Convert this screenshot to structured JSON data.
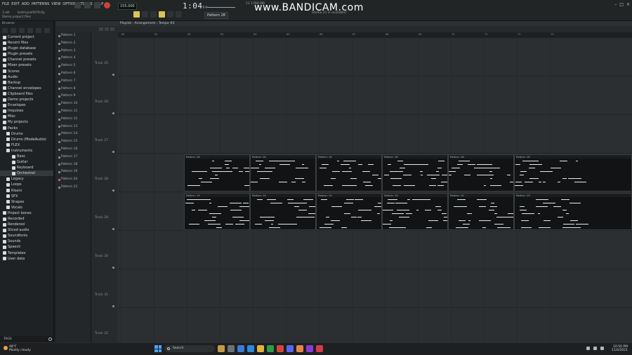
{
  "menu": [
    "FILE",
    "EDIT",
    "ADD",
    "PATTERNS",
    "VIEW",
    "OPTIONS",
    "TOOLS",
    "HELP"
  ],
  "hint_file": "3 ott",
  "hint_song": "lostmyself479.flp",
  "hint_project": "Demo project files",
  "tempo": "155.000",
  "time_main": "1:04",
  "time_small": "64",
  "cpu_text": "11  1780 MB",
  "watermark": "www.BANDICAM.com",
  "studio_note": "Studio 21 is available!",
  "pattern_selector": "Pattern 28",
  "playlist_title": "Playlist - Arrangement › Tempo #2",
  "browser_header": "Browser",
  "browser_items": [
    {
      "label": "Current project",
      "level": 0,
      "icon": "folder-icon"
    },
    {
      "label": "Recent files",
      "level": 0,
      "icon": "clock-icon"
    },
    {
      "label": "Plugin database",
      "level": 0,
      "icon": "plug-icon"
    },
    {
      "label": "Plugin presets",
      "level": 0,
      "icon": "plug-icon"
    },
    {
      "label": "Channel presets",
      "level": 0,
      "icon": "plug-icon"
    },
    {
      "label": "Mixer presets",
      "level": 0,
      "icon": "plug-icon"
    },
    {
      "label": "Scores",
      "level": 0,
      "icon": "note-icon"
    },
    {
      "label": "Audio",
      "level": 0,
      "icon": "audio-icon"
    },
    {
      "label": "Backup",
      "level": 0,
      "icon": "folder-icon"
    },
    {
      "label": "Channel envelopes",
      "level": 0,
      "icon": "folder-icon"
    },
    {
      "label": "Clipboard files",
      "level": 0,
      "icon": "folder-icon"
    },
    {
      "label": "Demo projects",
      "level": 0,
      "icon": "folder-icon"
    },
    {
      "label": "Envelopes",
      "level": 0,
      "icon": "folder-icon"
    },
    {
      "label": "Impulses",
      "level": 0,
      "icon": "folder-icon"
    },
    {
      "label": "Misc",
      "level": 0,
      "icon": "folder-icon"
    },
    {
      "label": "My projects",
      "level": 0,
      "icon": "folder-icon"
    },
    {
      "label": "Packs",
      "level": 0,
      "icon": "folder-open-icon"
    },
    {
      "label": "Drums",
      "level": 1,
      "icon": "folder-icon"
    },
    {
      "label": "Drums (ModeAudio)",
      "level": 1,
      "icon": "folder-icon"
    },
    {
      "label": "FLEX",
      "level": 1,
      "icon": "folder-icon"
    },
    {
      "label": "Instruments",
      "level": 1,
      "icon": "folder-open-icon"
    },
    {
      "label": "Bass",
      "level": 2,
      "icon": "folder-icon"
    },
    {
      "label": "Guitar",
      "level": 2,
      "icon": "folder-icon"
    },
    {
      "label": "Keyboard",
      "level": 2,
      "icon": "folder-icon"
    },
    {
      "label": "Orchestral",
      "level": 2,
      "icon": "folder-icon"
    },
    {
      "label": "Legacy",
      "level": 1,
      "icon": "folder-icon"
    },
    {
      "label": "Loops",
      "level": 1,
      "icon": "folder-icon"
    },
    {
      "label": "Risers",
      "level": 1,
      "icon": "folder-icon"
    },
    {
      "label": "SFX",
      "level": 1,
      "icon": "folder-icon"
    },
    {
      "label": "Shapes",
      "level": 1,
      "icon": "folder-icon"
    },
    {
      "label": "Vocals",
      "level": 1,
      "icon": "folder-icon"
    },
    {
      "label": "Project bones",
      "level": 0,
      "icon": "folder-icon"
    },
    {
      "label": "Recorded",
      "level": 0,
      "icon": "folder-icon"
    },
    {
      "label": "Rendered",
      "level": 0,
      "icon": "folder-icon"
    },
    {
      "label": "Sliced audio",
      "level": 0,
      "icon": "folder-icon"
    },
    {
      "label": "Soundfonts",
      "level": 0,
      "icon": "folder-icon"
    },
    {
      "label": "Sounds",
      "level": 0,
      "icon": "cloud-icon"
    },
    {
      "label": "Speech",
      "level": 0,
      "icon": "folder-icon"
    },
    {
      "label": "Templates",
      "level": 0,
      "icon": "folder-icon"
    },
    {
      "label": "User data",
      "level": 0,
      "icon": "folder-icon"
    }
  ],
  "browser_search": "TAGS",
  "patterns": [
    "Pattern 1",
    "Pattern 2",
    "Pattern 3",
    "Pattern 4",
    "Pattern 5",
    "Pattern 6",
    "Pattern 7",
    "Pattern 8",
    "Pattern 9",
    "Pattern 10",
    "Pattern 11",
    "Pattern 12",
    "Pattern 13",
    "Pattern 14",
    "Pattern 15",
    "Pattern 16",
    "Pattern 17",
    "Pattern 18",
    "Pattern 19",
    "Pattern 20",
    "Pattern 21"
  ],
  "tracks": [
    "Track 25",
    "Track 26",
    "Track 27",
    "Track 28",
    "Track 29",
    "Track 30",
    "Track 31",
    "Track 32"
  ],
  "ruler_ticks": [
    "60",
    "61",
    "62",
    "63",
    "64",
    "65",
    "66",
    "67",
    "68",
    "69",
    "70",
    "71",
    "72",
    "73"
  ],
  "clips_row1_label": "Pattern 18",
  "clips_row2_label": "Pattern 19",
  "taskbar": {
    "weather_temp": "48°F",
    "weather_desc": "Mostly cloudy",
    "search": "Search",
    "time": "10:50 PM",
    "date": "11/4/2021"
  },
  "colors": {
    "accent": "#d9c45a",
    "panel": "#1f2224",
    "grid": "#2c2f31"
  }
}
